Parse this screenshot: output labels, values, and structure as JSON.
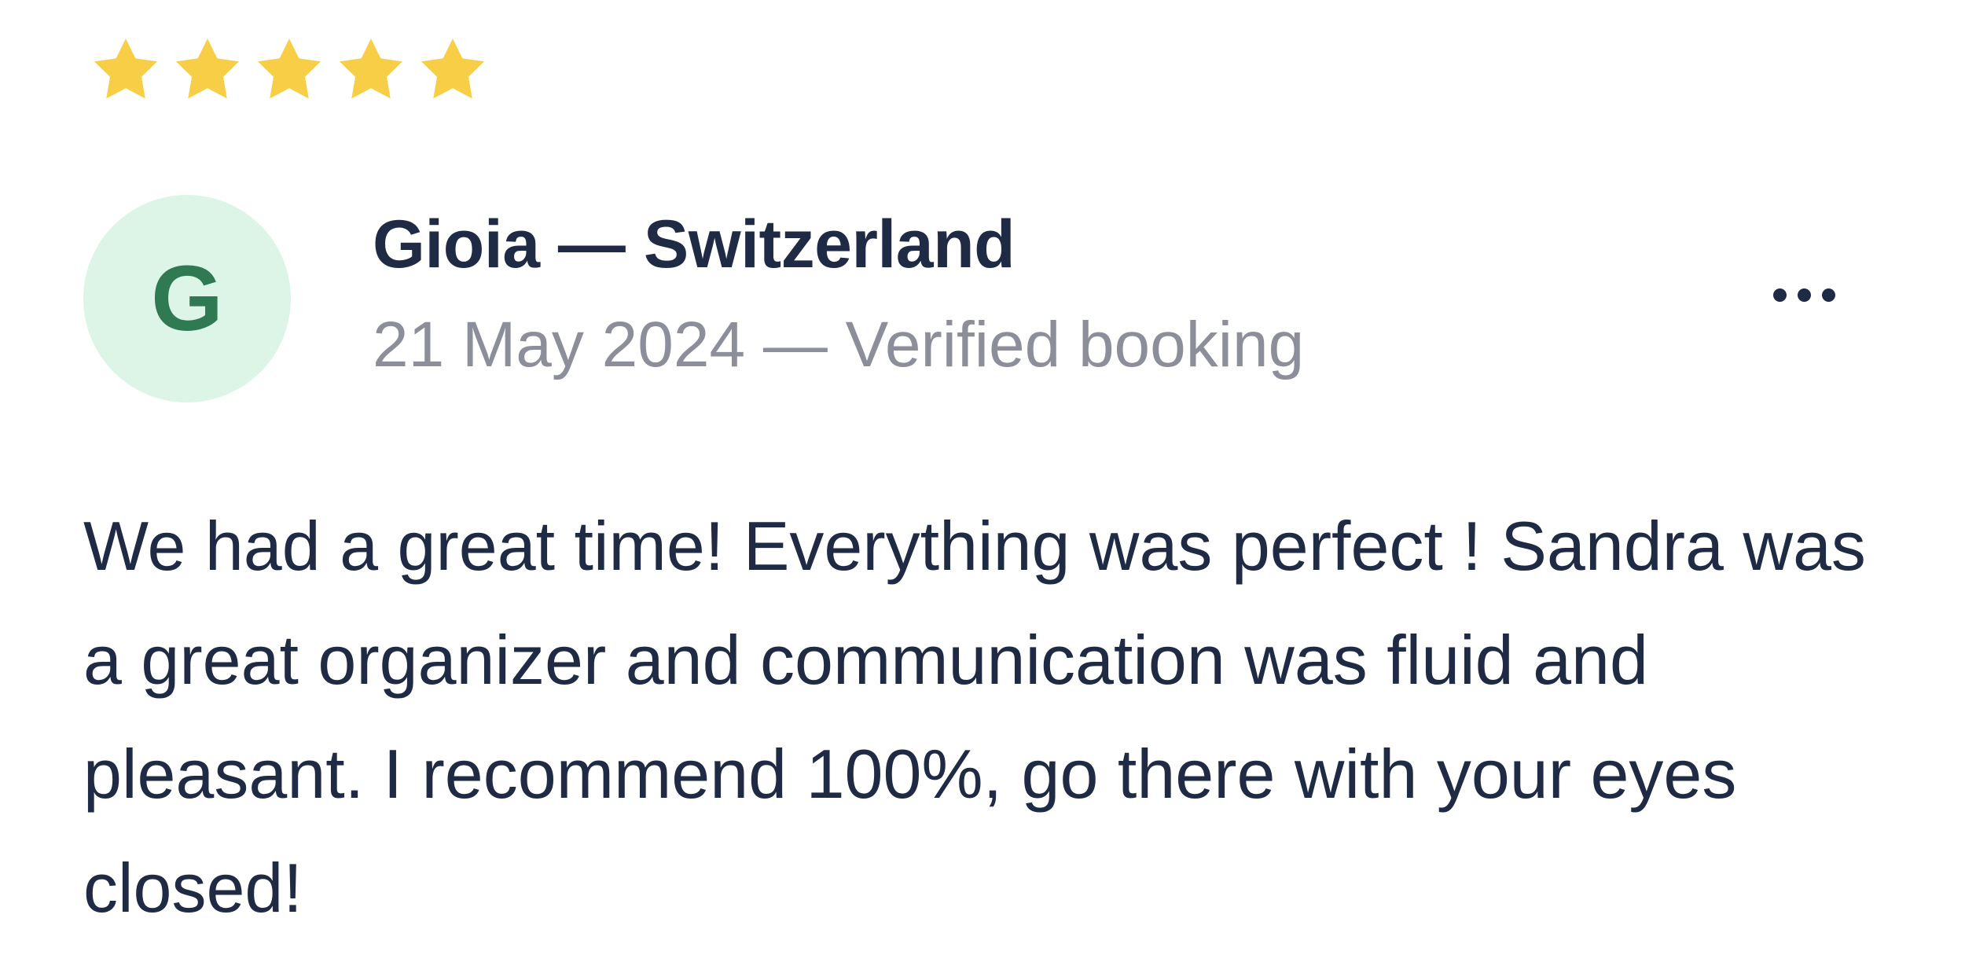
{
  "rating": {
    "value": 5,
    "max": 5,
    "star_color": "#F7CE46",
    "stars": [
      {
        "icon": "star-icon"
      },
      {
        "icon": "star-icon"
      },
      {
        "icon": "star-icon"
      },
      {
        "icon": "star-icon"
      },
      {
        "icon": "star-icon"
      }
    ]
  },
  "reviewer": {
    "avatar_initial": "G",
    "avatar_bg": "#DCF5E6",
    "avatar_fg": "#2F7A52",
    "name": "Gioia — Switzerland",
    "meta": "21 May 2024 — Verified booking"
  },
  "actions": {
    "more_icon": "more-horizontal-icon"
  },
  "review": {
    "text": "We had a great time! Everything was perfect ! Sandra was a great organizer and communication was fluid and pleasant. I recommend 100%, go there with your eyes closed!"
  }
}
